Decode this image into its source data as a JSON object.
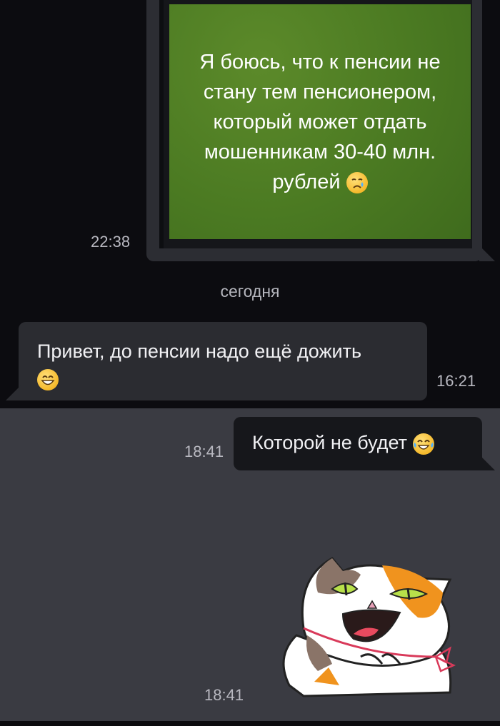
{
  "messages": [
    {
      "type": "outgoing-image",
      "image_text": "Я боюсь, что к пенсии не стану тем пенсионером, который может отдать мошенникам 30-40 млн. рублей",
      "emoji": "crying-face",
      "time": "22:38"
    },
    {
      "type": "date-separator",
      "label": "сегодня"
    },
    {
      "type": "incoming",
      "text": "Привет, до пенсии надо ещё дожить",
      "emoji": "grinning-face",
      "time": "16:21"
    },
    {
      "type": "outgoing",
      "text": "Которой не будет",
      "emoji": "tears-of-joy-face",
      "time": "18:41"
    },
    {
      "type": "sticker",
      "sticker": "laughing-cat-sticker",
      "time": "18:41"
    }
  ],
  "colors": {
    "dark_background": "#0c0c10",
    "chat_background": "#3a3b42",
    "quote_green": "#4b7a22",
    "bubble_incoming": "#2b2c31",
    "bubble_outgoing": "#16171b"
  }
}
